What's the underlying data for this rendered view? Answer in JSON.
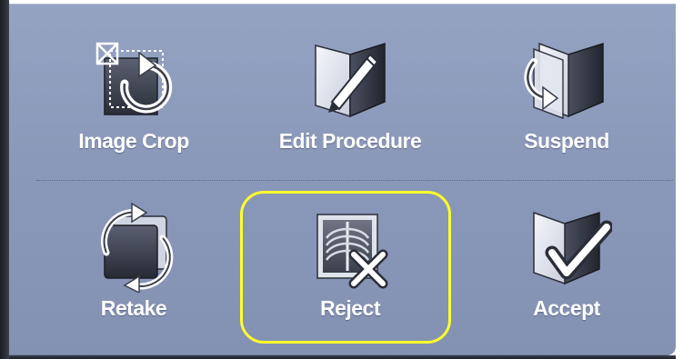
{
  "buttons": {
    "image_crop": {
      "label": "Image Crop",
      "icon": "image-crop-icon"
    },
    "edit_procedure": {
      "label": "Edit Procedure",
      "icon": "edit-procedure-icon"
    },
    "suspend": {
      "label": "Suspend",
      "icon": "suspend-icon"
    },
    "retake": {
      "label": "Retake",
      "icon": "retake-icon"
    },
    "reject": {
      "label": "Reject",
      "icon": "reject-icon",
      "selected": true
    },
    "accept": {
      "label": "Accept",
      "icon": "accept-icon"
    }
  },
  "colors": {
    "panel": "#8a98b9",
    "label": "#ffffff",
    "selection": "#ffff2a"
  }
}
